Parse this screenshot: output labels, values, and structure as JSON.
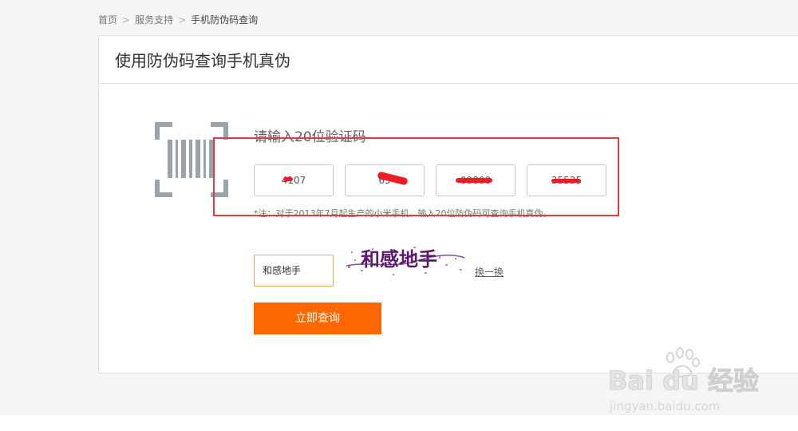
{
  "breadcrumb": {
    "items": [
      "首页",
      "服务支持",
      "手机防伪码查询"
    ],
    "separator": ">"
  },
  "page": {
    "title": "使用防伪码查询手机真伪"
  },
  "code_form": {
    "label": "请输入20位验证码",
    "fields": [
      {
        "visible_value": "4107"
      },
      {
        "visible_value": "65"
      },
      {
        "visible_value": "00000"
      },
      {
        "visible_value": "35535"
      }
    ],
    "note": "*注：对于2013年7月起生产的小米手机，输入20位防伪码可查询手机真伪。"
  },
  "captcha": {
    "input_value": "和感地手",
    "image_text": "和感地手",
    "refresh_label": "换一换"
  },
  "submit": {
    "label": "立即查询"
  },
  "watermark": {
    "brand": "Bai du 经验",
    "url": "jingyan.baidu.com"
  },
  "colors": {
    "accent": "#ff6700",
    "highlight": "#e63946",
    "redaction": "#ee1c25",
    "captcha_text": "#5b1a6e"
  }
}
